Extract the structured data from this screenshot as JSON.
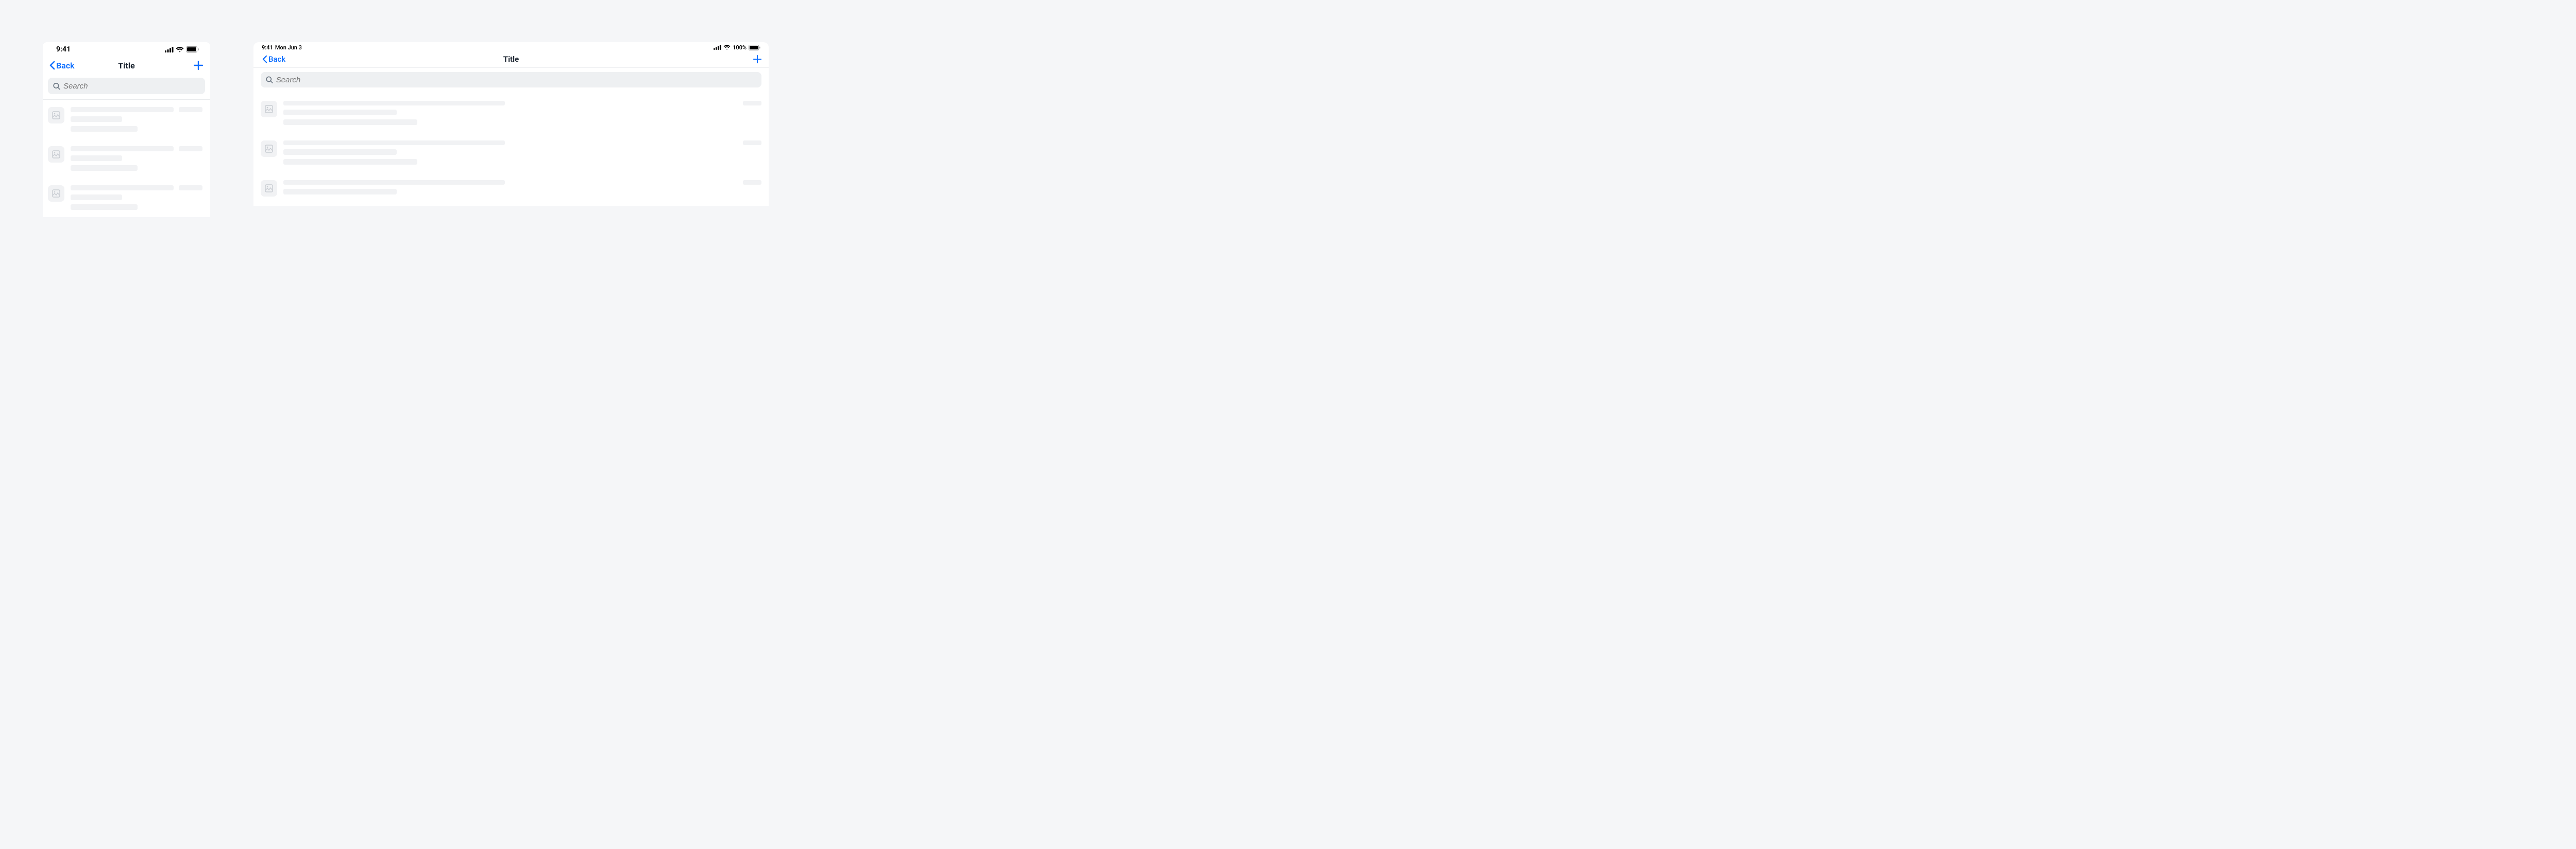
{
  "phone": {
    "statusbar": {
      "time": "9:41"
    },
    "nav": {
      "back_label": "Back",
      "title": "Title"
    },
    "search": {
      "placeholder": "Search"
    }
  },
  "tablet": {
    "statusbar": {
      "time": "9:41",
      "date": "Mon Jun 3",
      "battery": "100%"
    },
    "nav": {
      "back_label": "Back",
      "title": "Title"
    },
    "search": {
      "placeholder": "Search"
    }
  },
  "icons": {
    "chevron": "chevron-left-icon",
    "plus": "plus-icon",
    "search": "search-icon",
    "image": "image-placeholder-icon",
    "signal": "signal-icon",
    "wifi": "wifi-icon",
    "battery": "battery-icon"
  }
}
